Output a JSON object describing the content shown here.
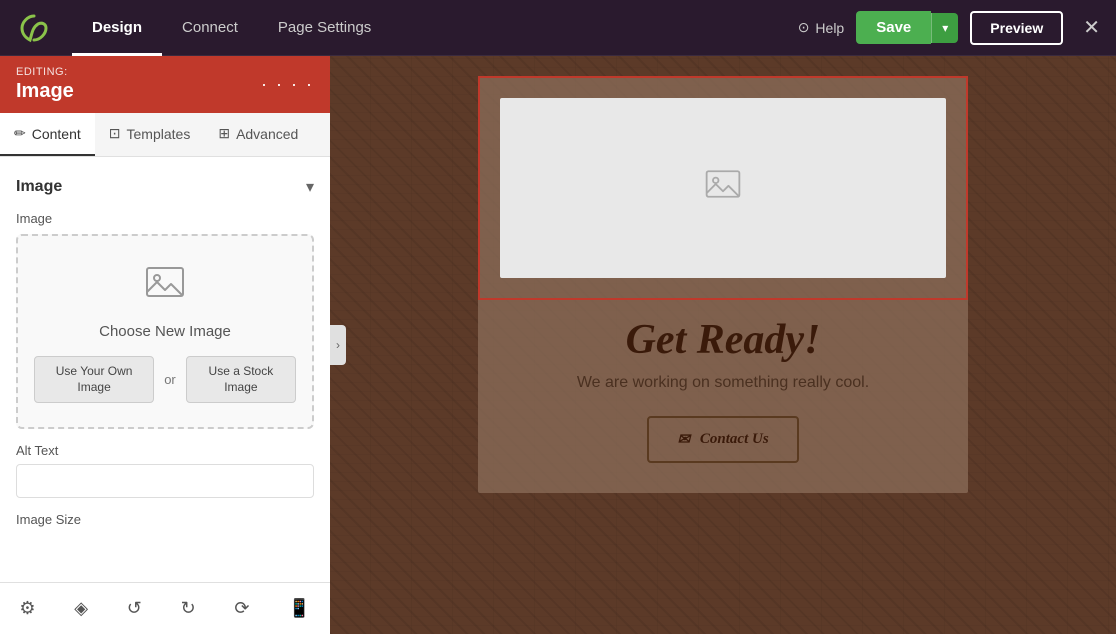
{
  "topNav": {
    "tabs": [
      {
        "label": "Design",
        "active": true
      },
      {
        "label": "Connect",
        "active": false
      },
      {
        "label": "Page Settings",
        "active": false
      }
    ],
    "helpLabel": "Help",
    "saveLabel": "Save",
    "previewLabel": "Preview",
    "closeIcon": "✕"
  },
  "editingHeader": {
    "editingLabel": "EDITING:",
    "editingTitle": "Image"
  },
  "subTabs": [
    {
      "label": "Content",
      "icon": "✏️",
      "active": true
    },
    {
      "label": "Templates",
      "icon": "🔲",
      "active": false
    },
    {
      "label": "Advanced",
      "icon": "⊞",
      "active": false
    }
  ],
  "imageSection": {
    "title": "Image",
    "fieldLabel": "Image",
    "chooseLabelText": "Choose New Image",
    "ownImageBtn": "Use Your Own Image",
    "orText": "or",
    "stockImageBtn": "Use a Stock Image",
    "altTextLabel": "Alt Text",
    "altTextPlaceholder": "",
    "imageSizeLabel": "Image Size"
  },
  "canvas": {
    "heading": "Get Ready!",
    "subtext": "We are working on something really cool.",
    "contactBtn": "Contact Us"
  },
  "bottomToolbar": {
    "icons": [
      "settings",
      "layers",
      "history-back",
      "history-forward",
      "refresh",
      "mobile"
    ]
  }
}
